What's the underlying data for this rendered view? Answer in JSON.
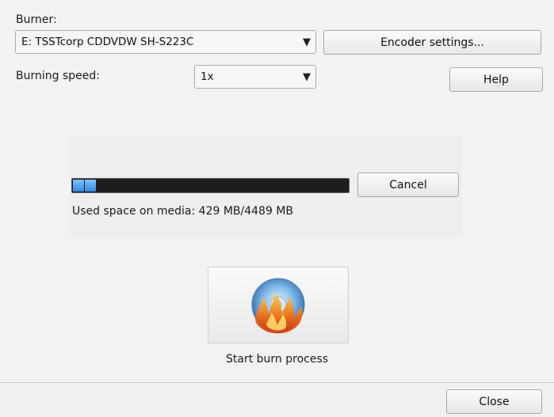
{
  "burner": {
    "label": "Burner:",
    "selected": "E: TSSTcorp CDDVDW SH-S223C",
    "arrow_icon": "▼"
  },
  "buttons": {
    "encoder_settings": "Encoder settings...",
    "help": "Help",
    "cancel": "Cancel",
    "close": "Close"
  },
  "burning_speed": {
    "label": "Burning speed:",
    "selected": "1x",
    "arrow_icon": "▼"
  },
  "progress": {
    "used_mb": 429,
    "total_mb": 4489,
    "status_text": "Used space on media: 429 MB/4489 MB",
    "fill_color": "#3d95ea",
    "track_color": "#1e1e1e"
  },
  "start": {
    "label": "Start burn process",
    "icon": "burning-disc-icon"
  }
}
